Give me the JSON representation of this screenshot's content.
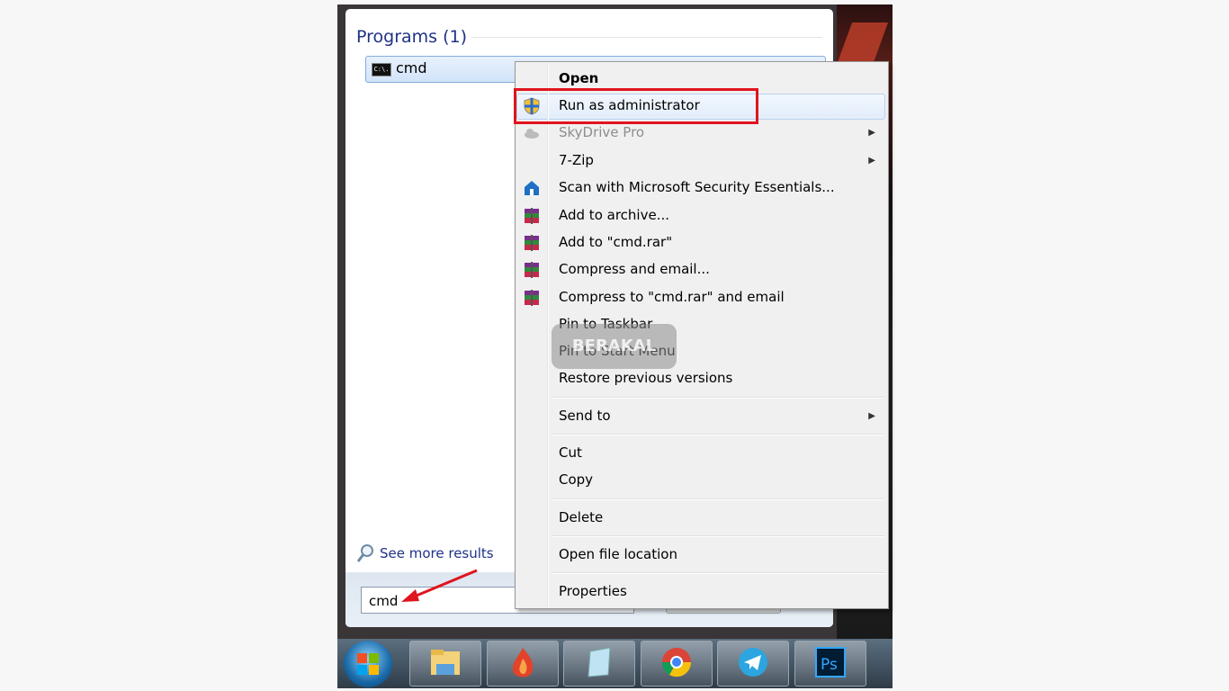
{
  "start_menu": {
    "programs_header": "Programs (1)",
    "program_item": {
      "label": "cmd",
      "icon": "command-prompt-icon"
    },
    "see_more": "See more results",
    "search_value": "cmd"
  },
  "context_menu": {
    "items": [
      {
        "label": "Open",
        "bold": true
      },
      {
        "label": "Run as administrator",
        "icon": "uac-shield-icon",
        "highlighted": true
      },
      {
        "label": "SkyDrive Pro",
        "icon": "skydrive-icon",
        "disabled": true,
        "submenu": true
      },
      {
        "label": "7-Zip",
        "submenu": true
      },
      {
        "label": "Scan with Microsoft Security Essentials...",
        "icon": "security-essentials-icon"
      },
      {
        "label": "Add to archive...",
        "icon": "winrar-icon"
      },
      {
        "label": "Add to \"cmd.rar\"",
        "icon": "winrar-icon"
      },
      {
        "label": "Compress and email...",
        "icon": "winrar-icon"
      },
      {
        "label": "Compress to \"cmd.rar\" and email",
        "icon": "winrar-icon"
      },
      {
        "label": "Pin to Taskbar"
      },
      {
        "label": "Pin to Start Menu"
      },
      {
        "label": "Restore previous versions"
      },
      {
        "label": "Send to",
        "submenu": true
      },
      {
        "label": "Cut"
      },
      {
        "label": "Copy"
      },
      {
        "label": "Delete"
      },
      {
        "label": "Open file location"
      },
      {
        "label": "Properties"
      }
    ]
  },
  "watermark": "BERAKAL",
  "taskbar": {
    "apps": [
      "file-explorer-icon",
      "burning-app-icon",
      "notepad-icon",
      "chrome-icon",
      "telegram-icon",
      "photoshop-icon"
    ],
    "photoshop_label": "Ps"
  },
  "colors": {
    "highlight_box": "#e0141e",
    "header_blue": "#1e3287",
    "arrow": "#e0141e"
  }
}
